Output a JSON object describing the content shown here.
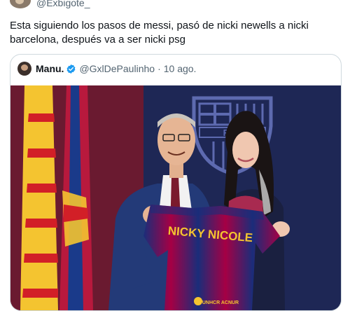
{
  "tweet": {
    "author_handle": "@Exbigote_",
    "text_line1": "Esta siguiendo los pasos de messi, pasó de nicki newells a nicki",
    "text_line2": "barcelona, después va a ser nicki psg"
  },
  "quoted_tweet": {
    "author_name": "Manu.",
    "author_handle": "@GxlDePaulinho",
    "separator": "·",
    "time": "10 ago.",
    "verified": true,
    "photo": {
      "crest_text": "FCB",
      "jersey_text": "NICKY NICOLE",
      "jersey_sponsor": "UNHCR ACNUR",
      "icons": [
        "fcb-crest",
        "catalan-flag",
        "barcelona-flag"
      ],
      "colors": {
        "background": "#2a1a3a",
        "blaugrana_red": "#a50044",
        "blaugrana_blue": "#004d98",
        "flag_yellow": "#f4c430"
      }
    }
  }
}
